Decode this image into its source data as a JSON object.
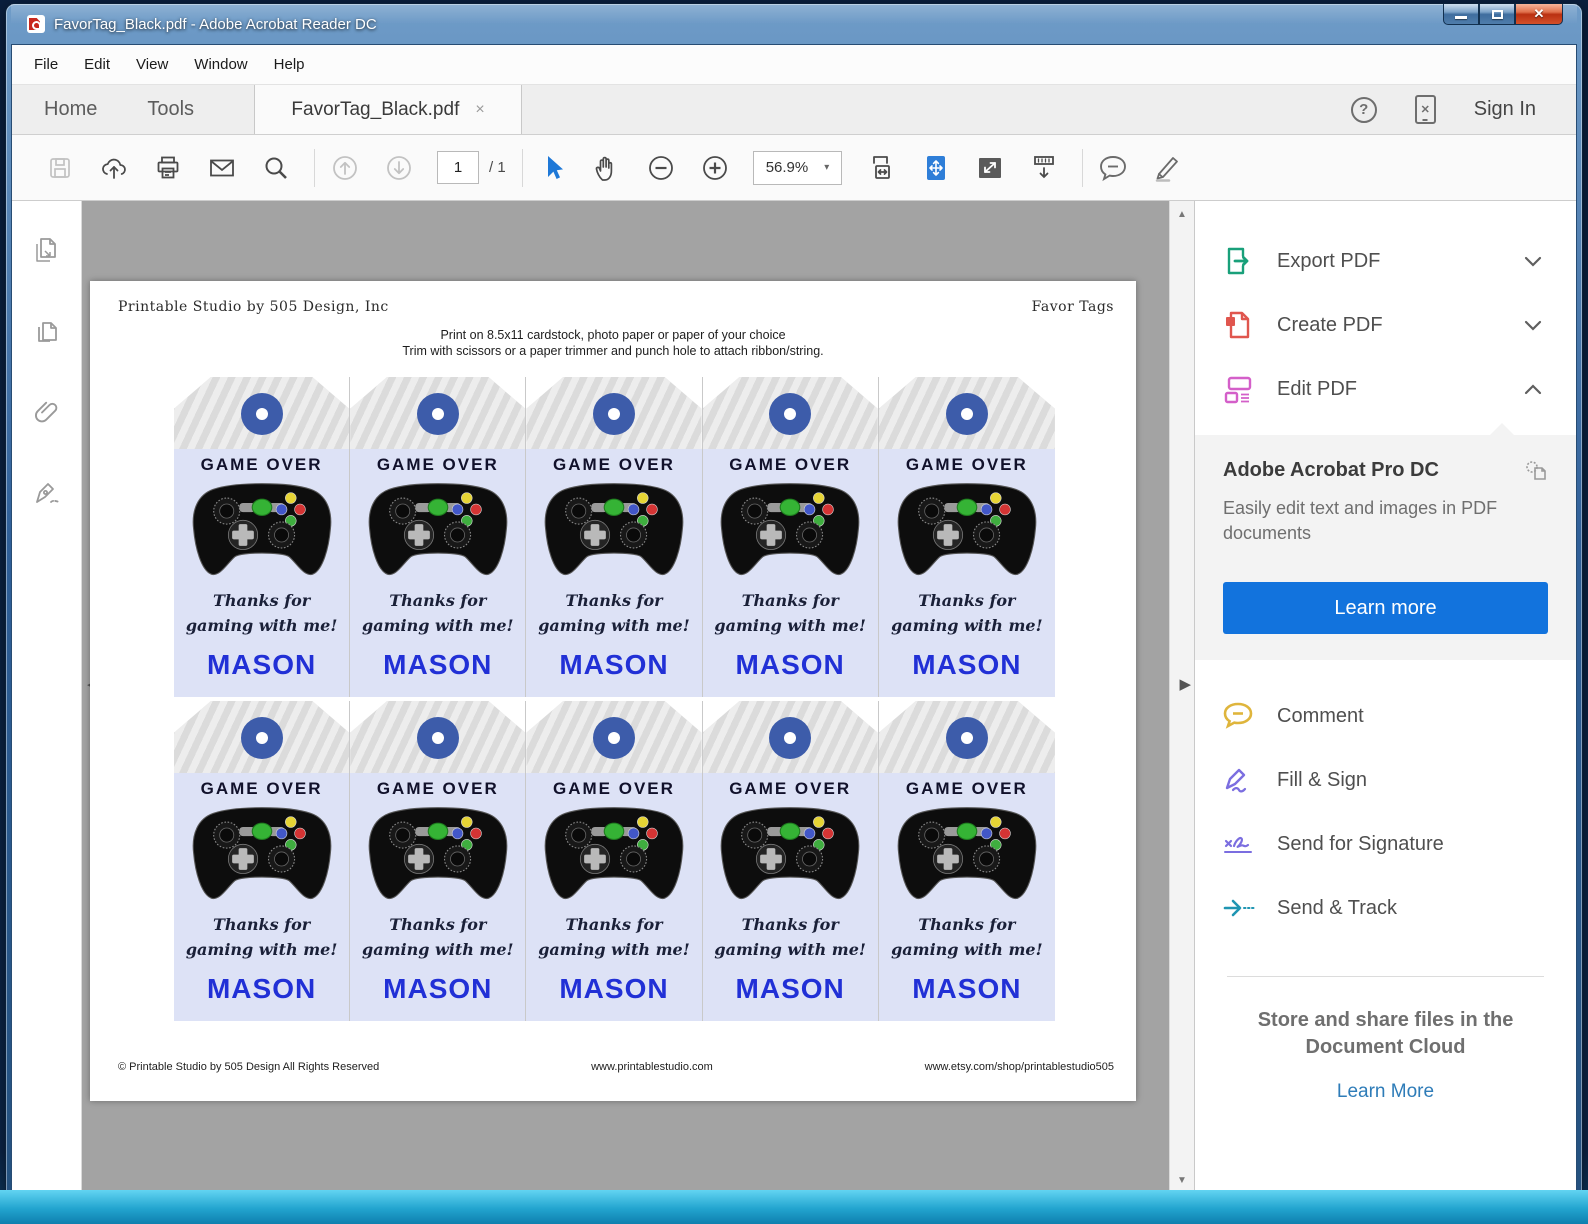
{
  "window": {
    "title": "FavorTag_Black.pdf - Adobe Acrobat Reader DC"
  },
  "menu": {
    "items": [
      "File",
      "Edit",
      "View",
      "Window",
      "Help"
    ]
  },
  "tabs": {
    "home": "Home",
    "tools": "Tools",
    "document": "FavorTag_Black.pdf",
    "close": "×",
    "help_glyph": "?",
    "sign_in": "Sign In"
  },
  "toolbar": {
    "page_current": "1",
    "page_total": "/ 1",
    "zoom_level": "56.9%",
    "zoom_caret": "▾"
  },
  "scroll": {
    "up": "▲",
    "down": "▼",
    "nav_left": "◀",
    "nav_right": "▶"
  },
  "document": {
    "header_left": "Printable Studio by 505 Design, Inc",
    "header_right": "Favor Tags",
    "instruction_line1": "Print on 8.5x11 cardstock, photo paper or paper of your choice",
    "instruction_line2": "Trim with scissors or a paper trimmer and punch hole to attach ribbon/string.",
    "tag": {
      "count": 10,
      "columns": 5,
      "title": "GAME OVER",
      "message_line1": "Thanks for",
      "message_line2": "gaming with me!",
      "name": "MASON"
    },
    "footer_left": "© Printable Studio by 505 Design All Rights Reserved",
    "footer_center": "www.printablestudio.com",
    "footer_right": "www.etsy.com/shop/printablestudio505"
  },
  "right_panel": {
    "top_tools": [
      {
        "label": "Export PDF"
      },
      {
        "label": "Create PDF"
      },
      {
        "label": "Edit PDF"
      }
    ],
    "promo": {
      "title": "Adobe Acrobat Pro DC",
      "description": "Easily edit text and images in PDF documents",
      "button": "Learn more"
    },
    "bottom_tools": [
      {
        "label": "Comment"
      },
      {
        "label": "Fill & Sign"
      },
      {
        "label": "Send for Signature"
      },
      {
        "label": "Send & Track"
      }
    ],
    "footer": {
      "text": "Store and share files in the Document Cloud",
      "link": "Learn More"
    }
  },
  "colors": {
    "titlebar_blue": "#2f5f98",
    "adobe_button_blue": "#1273dd",
    "active_tool_blue": "#2e7ed8",
    "cursor_blue": "#1e78d7",
    "export_green": "#19a07a",
    "create_red": "#e0564e",
    "edit_pink": "#d45fc9",
    "comment_yellow": "#dfb53c",
    "sign_purple": "#7b6ee0",
    "track_teal": "#1f95b2",
    "tag_body_lavender": "#dde2f6",
    "tag_hole_blue": "#3d5caa",
    "tag_name_blue": "#2130d6",
    "controller_green": "#35b335"
  }
}
